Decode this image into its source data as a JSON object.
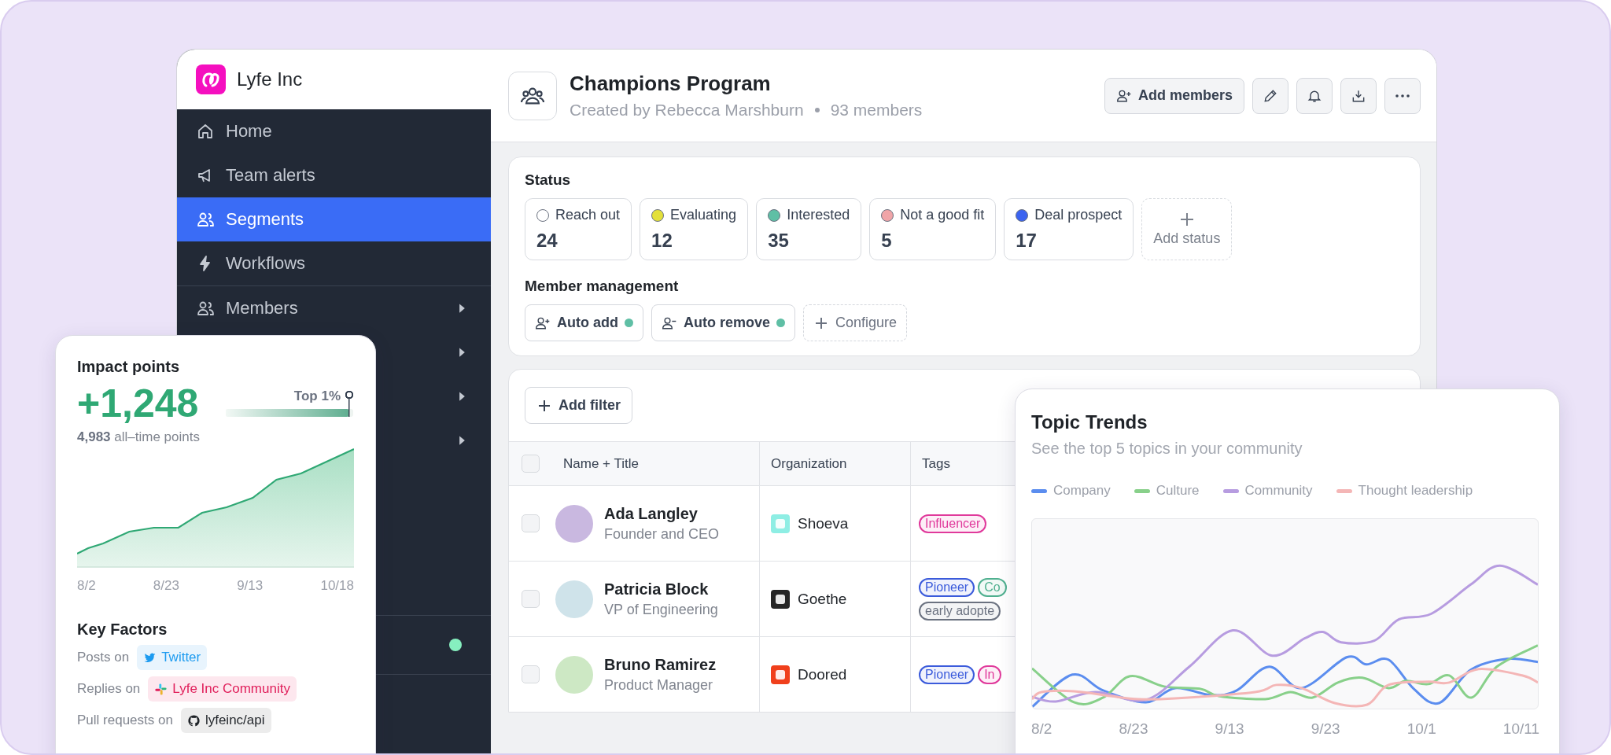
{
  "brand": {
    "name": "Lyfe Inc"
  },
  "sidebar": {
    "sections": [
      [
        {
          "label": "Home",
          "selected": false
        },
        {
          "label": "Team alerts",
          "selected": false
        },
        {
          "label": "Segments",
          "selected": true
        },
        {
          "label": "Workflows",
          "selected": false
        }
      ],
      [
        {
          "label": "Members",
          "selected": false,
          "has_submenu": true
        },
        {
          "has_submenu": true
        },
        {
          "has_submenu": true
        },
        {
          "has_submenu": true
        }
      ],
      [
        {
          "color": "#86efbf"
        }
      ]
    ]
  },
  "header": {
    "title": "Champions Program",
    "creator": "Created by Rebecca Marshburn",
    "members": "93 members",
    "add_button": "Add members"
  },
  "status": {
    "title": "Status",
    "add_label": "Add status",
    "items": [
      {
        "label": "Reach out",
        "count": "24",
        "color": "#ffffff"
      },
      {
        "label": "Evaluating",
        "count": "12",
        "color": "#e3e03a"
      },
      {
        "label": "Interested",
        "count": "35",
        "color": "#5fbfa5"
      },
      {
        "label": "Not a good fit",
        "count": "5",
        "color": "#f0a5a8"
      },
      {
        "label": "Deal prospect",
        "count": "17",
        "color": "#3b63f0"
      }
    ]
  },
  "member_management": {
    "title": "Member management",
    "actions": [
      {
        "kind": "add_rule",
        "label": "Auto add",
        "on": true
      },
      {
        "kind": "remove_rule",
        "label": "Auto remove",
        "on": true
      },
      {
        "kind": "configure",
        "label": "Configure"
      }
    ]
  },
  "table": {
    "filter_button": "Add filter",
    "header_checked": false,
    "columns": [
      "Name + Title",
      "Organization",
      "Tags"
    ],
    "rows": [
      {
        "checked": false,
        "name": "Ada Langley",
        "title": "Founder and CEO",
        "org": {
          "name": "Shoeva",
          "color": "#8eeee4"
        },
        "tags": [
          {
            "label": "Influencer",
            "color": "#e0399b"
          }
        ]
      },
      {
        "checked": false,
        "name": "Patricia Block",
        "title": "VP of Engineering",
        "org": {
          "name": "Goethe",
          "color": "#262626"
        },
        "tags": [
          {
            "label": "Pioneer",
            "color": "#3b5bdb"
          },
          {
            "label": "Co",
            "color": "#4fb08f"
          },
          {
            "label": "early adopte",
            "color": "#6b7280"
          }
        ]
      },
      {
        "checked": false,
        "name": "Bruno Ramirez",
        "title": "Product Manager",
        "org": {
          "name": "Doored",
          "color": "#f0401c"
        },
        "tags": [
          {
            "label": "Pioneer",
            "color": "#3b5bdb"
          },
          {
            "label": "In",
            "color": "#e0399b"
          }
        ]
      }
    ]
  },
  "impact": {
    "title": "Impact points",
    "value": "+1,248",
    "rank_label": "Top 1%",
    "level": 0.97,
    "total": "**4,983** all–time points",
    "x_labels": [
      "8/2",
      "8/23",
      "9/13",
      "10/18"
    ],
    "factors_title": "Key Factors",
    "factors": [
      {
        "label": "Posts on",
        "chip": "Twitter",
        "kind": "twitter"
      },
      {
        "label": "Replies on",
        "chip": "Lyfe Inc Community",
        "kind": "slack"
      },
      {
        "label": "Pull requests on",
        "chip": "lyfeinc/api",
        "kind": "github"
      }
    ]
  },
  "trends": {
    "title": "Topic Trends",
    "subtitle": "See the top 5 topics in your community",
    "legend": [
      {
        "label": "Company",
        "color": "#5b8def"
      },
      {
        "label": "Culture",
        "color": "#88d08a"
      },
      {
        "label": "Community",
        "color": "#b79ce0"
      },
      {
        "label": "Thought leadership",
        "color": "#f4b6b6"
      }
    ],
    "x_labels": [
      "8/2",
      "8/23",
      "9/13",
      "9/23",
      "10/1",
      "10/11"
    ]
  }
}
